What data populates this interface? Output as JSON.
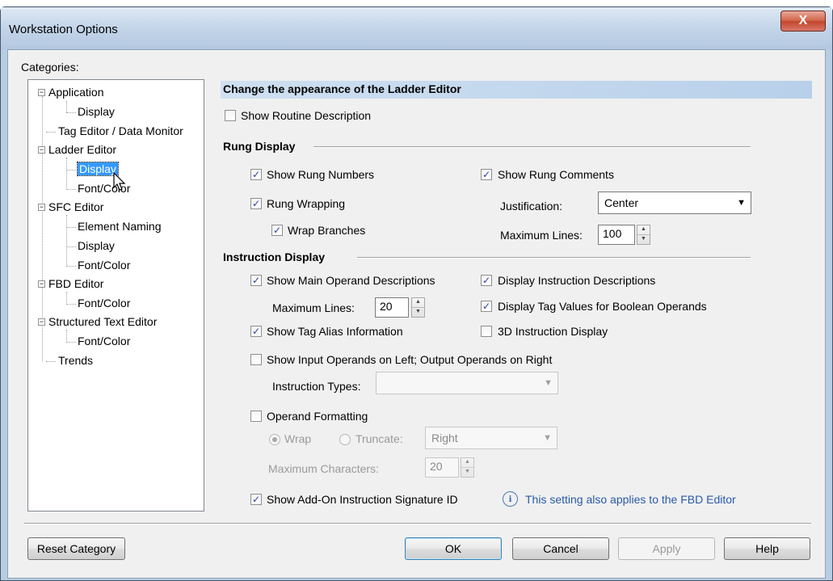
{
  "window": {
    "title": "Workstation Options",
    "close_glyph": "X"
  },
  "categories_label": "Categories:",
  "tree": {
    "application": "Application",
    "application_display": "Display",
    "tag_editor": "Tag Editor / Data Monitor",
    "ladder_editor": "Ladder Editor",
    "ladder_display": "Display",
    "ladder_font_color": "Font/Color",
    "sfc_editor": "SFC Editor",
    "sfc_element_naming": "Element Naming",
    "sfc_display": "Display",
    "sfc_font_color": "Font/Color",
    "fbd_editor": "FBD Editor",
    "fbd_font_color": "Font/Color",
    "st_editor": "Structured Text Editor",
    "st_font_color": "Font/Color",
    "trends": "Trends",
    "expander_glyph": "−"
  },
  "header": "Change the appearance of the Ladder Editor",
  "show_routine_description": {
    "label": "Show Routine Description",
    "checked": false
  },
  "rung_display": {
    "title": "Rung Display",
    "show_rung_numbers": {
      "label": "Show Rung Numbers",
      "checked": true
    },
    "show_rung_comments": {
      "label": "Show Rung Comments",
      "checked": true
    },
    "rung_wrapping": {
      "label": "Rung Wrapping",
      "checked": true
    },
    "wrap_branches": {
      "label": "Wrap Branches",
      "checked": true
    },
    "justification_label": "Justification:",
    "justification_value": "Center",
    "max_lines_label": "Maximum Lines:",
    "max_lines_value": "100"
  },
  "instruction_display": {
    "title": "Instruction Display",
    "main_operand_desc": {
      "label": "Show Main Operand Descriptions",
      "checked": true
    },
    "instruction_desc": {
      "label": "Display Instruction Descriptions",
      "checked": true
    },
    "max_lines_label": "Maximum Lines:",
    "max_lines_value": "20",
    "tag_values_boolean": {
      "label": "Display Tag Values for Boolean Operands",
      "checked": true
    },
    "tag_alias_info": {
      "label": "Show Tag Alias Information",
      "checked": true
    },
    "three_d_display": {
      "label": "3D Instruction Display",
      "checked": false
    },
    "input_output_operands": {
      "label": "Show Input Operands on Left; Output Operands on Right",
      "checked": false
    },
    "instruction_types_label": "Instruction Types:",
    "instruction_types_value": "",
    "operand_formatting": {
      "label": "Operand Formatting",
      "checked": false
    },
    "wrap_label": "Wrap",
    "truncate_label": "Truncate:",
    "truncate_value": "Right",
    "max_chars_label": "Maximum Characters:",
    "max_chars_value": "20",
    "signature_id": {
      "label": "Show Add-On Instruction Signature ID",
      "checked": true
    },
    "fbd_note": "This setting also applies to the FBD Editor",
    "info_glyph": "i"
  },
  "buttons": {
    "reset_category": "Reset Category",
    "ok": "OK",
    "cancel": "Cancel",
    "apply": "Apply",
    "help": "Help"
  },
  "glyphs": {
    "check": "✓",
    "dropdown": "▼",
    "spin_up": "▲",
    "spin_down": "▼"
  },
  "colors": {
    "selection": "#3399ff",
    "header_bar": "#b8d0ea",
    "info_text": "#2a5aa8",
    "close_button": "#c2462b"
  }
}
